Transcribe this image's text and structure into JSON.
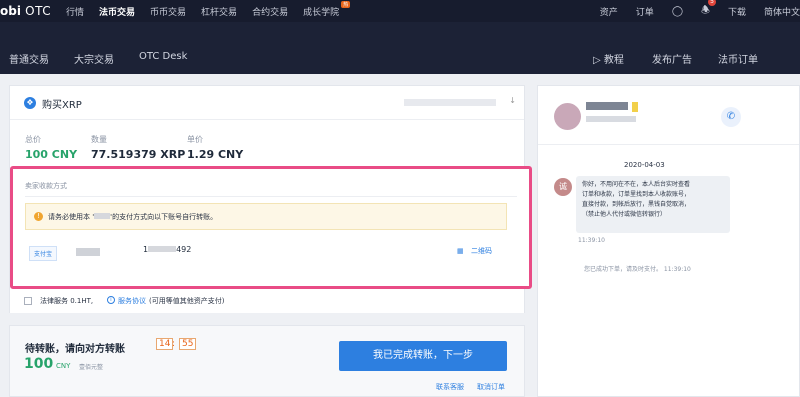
{
  "brand": {
    "logo_bold": "obi",
    "logo_text": "OTC"
  },
  "top_nav": {
    "items": [
      "行情",
      "法币交易",
      "币币交易",
      "杠杆交易",
      "合约交易",
      "成长学院"
    ],
    "active": "法币交易",
    "hot_badge": "热",
    "right": {
      "assets": "资产",
      "orders": "订单",
      "notifications": "5",
      "download": "下载",
      "language": "简体中文"
    }
  },
  "sub_nav": {
    "left": [
      "普通交易",
      "大宗交易",
      "OTC Desk"
    ],
    "right": [
      "教程",
      "发布广告",
      "法币订单"
    ]
  },
  "order": {
    "title": "购买XRP",
    "total_label": "总价",
    "total_value": "100 CNY",
    "qty_label": "数量",
    "qty_value": "77.519379 XRP",
    "price_label": "单价",
    "price_value": "1.29 CNY"
  },
  "payment": {
    "header": "卖家收款方式",
    "notice_icon": "!",
    "notice_prefix": "请务必使用本 '",
    "notice_suffix": "'的支付方式向以下账号自行转账。",
    "method": "支付宝",
    "account_prefix": "1",
    "account_suffix": "492",
    "qr_label": "二维码"
  },
  "legal": {
    "label": "法律服务 0.1HT,",
    "info_icon": "i",
    "agreement": "服务协议",
    "note": "(可用等值其他资产支付)"
  },
  "transfer": {
    "title": "待转账，请向对方转账",
    "min": "14",
    "sec": "55",
    "amount": "100",
    "currency": "CNY",
    "amount_words": "壹佰元整",
    "confirm_button": "我已完成转账，下一步",
    "contact": "联系客服",
    "cancel": "取消订单"
  },
  "chat": {
    "date": "2020-04-03",
    "avatar_char": "诚",
    "message_lines": [
      "你好，不用问在不在，本人后台实时查看",
      "订单和收款，订单里找到本人收款账号，",
      "直接付款，到帐后放行，黑钱自觉取消，",
      "（禁止他人代付或微信转银行）"
    ],
    "message_time": "11:39:10",
    "system_message": "您已成功下单，请及时支付。 11:39:10"
  }
}
